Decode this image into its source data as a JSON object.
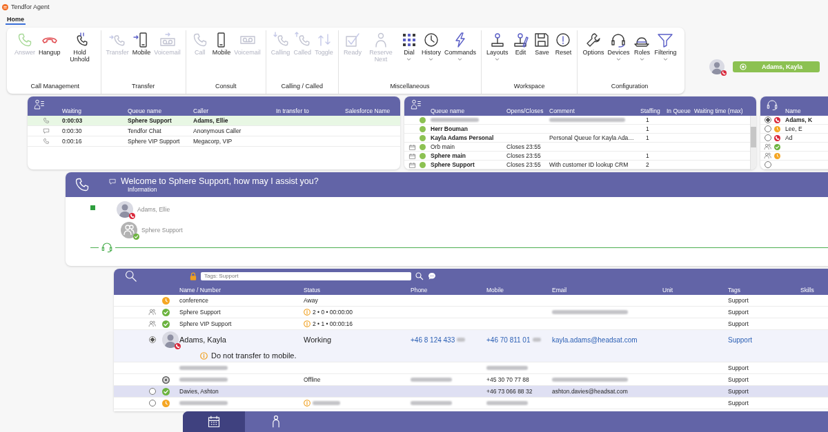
{
  "window": {
    "title": "Tendfor Agent"
  },
  "tabs": [
    {
      "label": "Home",
      "selected": true
    }
  ],
  "ribbon": [
    {
      "label": "Call Management",
      "buttons": [
        {
          "label": "Answer",
          "disabled": true,
          "dropdown": false
        },
        {
          "label": "Hangup",
          "disabled": false,
          "dropdown": false
        },
        {
          "label": "Hold Unhold",
          "disabled": false,
          "dropdown": false
        }
      ]
    },
    {
      "label": "Transfer",
      "buttons": [
        {
          "label": "Transfer",
          "disabled": true,
          "dropdown": false
        },
        {
          "label": "Mobile",
          "disabled": false,
          "dropdown": false
        },
        {
          "label": "Voicemail",
          "disabled": true,
          "dropdown": false
        }
      ]
    },
    {
      "label": "Consult",
      "buttons": [
        {
          "label": "Call",
          "disabled": true,
          "dropdown": false
        },
        {
          "label": "Mobile",
          "disabled": false,
          "dropdown": false
        },
        {
          "label": "Voicemail",
          "disabled": true,
          "dropdown": false
        }
      ]
    },
    {
      "label": "Calling / Called",
      "buttons": [
        {
          "label": "Calling",
          "disabled": true,
          "dropdown": false
        },
        {
          "label": "Called",
          "disabled": true,
          "dropdown": false
        },
        {
          "label": "Toggle",
          "disabled": true,
          "dropdown": false
        }
      ]
    },
    {
      "label": "Miscellaneous",
      "buttons": [
        {
          "label": "Ready",
          "disabled": true,
          "dropdown": false
        },
        {
          "label": "Reserve Next",
          "disabled": true,
          "dropdown": false
        },
        {
          "label": "Dial",
          "disabled": false,
          "dropdown": true
        },
        {
          "label": "History",
          "disabled": false,
          "dropdown": true
        },
        {
          "label": "Commands",
          "disabled": false,
          "dropdown": true
        }
      ]
    },
    {
      "label": "Workspace",
      "buttons": [
        {
          "label": "Layouts",
          "disabled": false,
          "dropdown": true
        },
        {
          "label": "Edit",
          "disabled": false,
          "dropdown": false
        },
        {
          "label": "Save",
          "disabled": false,
          "dropdown": false
        },
        {
          "label": "Reset",
          "disabled": false,
          "dropdown": false
        }
      ]
    },
    {
      "label": "Configuration",
      "buttons": [
        {
          "label": "Options",
          "disabled": false,
          "dropdown": false
        },
        {
          "label": "Devices",
          "disabled": false,
          "dropdown": true
        },
        {
          "label": "Roles",
          "disabled": false,
          "dropdown": true
        },
        {
          "label": "Filtering",
          "disabled": false,
          "dropdown": true
        }
      ]
    }
  ],
  "user": {
    "name": "Adams, Kayla",
    "status": {
      "kind": "busy",
      "color": "#d9283b"
    }
  },
  "waiting": {
    "columns": [
      "Waiting",
      "Queue name",
      "Caller",
      "In transfer to",
      "Salesforce Name"
    ],
    "rows": [
      {
        "kind": "phone",
        "waiting": "0:00:03",
        "queue": "Sphere Support",
        "caller": "Adams, Ellie",
        "selected": true
      },
      {
        "kind": "chat",
        "waiting": "0:00:30",
        "queue": "Tendfor Chat",
        "caller": "Anonymous Caller",
        "selected": false
      },
      {
        "kind": "phone",
        "waiting": "0:00:16",
        "queue": "Sphere VIP Support",
        "caller": "Megacorp, VIP",
        "selected": false
      }
    ]
  },
  "queues": {
    "columns": [
      "Queue name",
      "Opens/Closes",
      "Comment",
      "Staffing",
      "In Queue",
      "Waiting time (max)"
    ],
    "rows": [
      {
        "name_blurred": true,
        "comment_blurred": true,
        "staffing": "1",
        "scheduled": false
      },
      {
        "name": "Herr Bouman",
        "active": true,
        "staffing": "1",
        "scheduled": false
      },
      {
        "name": "Kayla Adams Personal",
        "active": true,
        "comment": "Personal Queue for Kayla Ada…",
        "staffing": "1",
        "scheduled": false
      },
      {
        "name": "Orb main",
        "active": false,
        "hours": "Closes 23:55",
        "scheduled": true
      },
      {
        "name": "Sphere main",
        "active": true,
        "hours": "Closes 23:55",
        "staffing": "1",
        "scheduled": true
      },
      {
        "name": "Sphere Support",
        "active": true,
        "hours": "Closes 23:55",
        "comment": "With customer ID lookup CRM",
        "staffing": "2",
        "scheduled": true
      }
    ]
  },
  "agents": {
    "columns": [
      "Name"
    ],
    "rows": [
      {
        "kind": "person",
        "selected": true,
        "status": {
          "kind": "busy",
          "color": "#d9283b"
        },
        "name": "Adams, K"
      },
      {
        "kind": "person",
        "selected": false,
        "status": {
          "kind": "away",
          "color": "#f5a623"
        },
        "name": "Lee, E"
      },
      {
        "kind": "person",
        "selected": false,
        "status": {
          "kind": "busy",
          "color": "#d9283b"
        },
        "name": "Ad"
      },
      {
        "kind": "group",
        "status": {
          "kind": "available",
          "color": "#6cb33f"
        }
      },
      {
        "kind": "group",
        "status": {
          "kind": "away",
          "color": "#f5a623"
        }
      },
      {
        "kind": "person",
        "selected": false
      }
    ]
  },
  "call": {
    "title": "Welcome to Sphere Support, how may I assist you?",
    "subtitle": "Information",
    "connected": true,
    "participants": [
      {
        "kind": "person",
        "name": "Adams, Ellie",
        "status": {
          "kind": "busy",
          "color": "#d9283b"
        }
      },
      {
        "kind": "group",
        "name": "Sphere Support",
        "status": {
          "kind": "available",
          "color": "#6cb33f"
        }
      }
    ]
  },
  "directory": {
    "search": {
      "value": "Tags: Support"
    },
    "columns": [
      "Name / Number",
      "Status",
      "Phone",
      "Mobile",
      "Email",
      "Unit",
      "Tags",
      "Skills"
    ],
    "rows": [
      {
        "kind": "number",
        "expanded": false,
        "highlighted": false,
        "status": {
          "kind": "away",
          "color": "#f5a623"
        },
        "name": "conference",
        "status_text": "Away",
        "tags": "Support"
      },
      {
        "kind": "group",
        "expanded": false,
        "highlighted": false,
        "status": {
          "kind": "available",
          "color": "#6cb33f"
        },
        "name": "Sphere Support",
        "queue_stats": "2 • 0 • 00:00:00",
        "email_blurred": true,
        "tags": "Support"
      },
      {
        "kind": "group",
        "expanded": false,
        "highlighted": false,
        "status": {
          "kind": "available",
          "color": "#6cb33f"
        },
        "name": "Sphere VIP Support",
        "queue_stats": "2 • 1 • 00:00:16",
        "tags": "Support"
      },
      {
        "kind": "person",
        "selected": true,
        "expanded": true,
        "highlighted": false,
        "status": {
          "kind": "busy",
          "color": "#d9283b"
        },
        "name": "Adams, Kayla",
        "status_text": "Working",
        "phone": "+46 8 124 433",
        "phone_blurred": true,
        "mobile": "+46 70 811 01",
        "mobile_blurred": true,
        "email": "kayla.adams@headsat.com",
        "tags": "Support",
        "note": "Do not transfer to mobile."
      },
      {
        "kind": "plain",
        "expanded": false,
        "highlighted": false,
        "name_blurred": true,
        "mobile_blurred": true,
        "tags": "Support"
      },
      {
        "kind": "plain",
        "expanded": false,
        "highlighted": false,
        "status": {
          "kind": "offline",
          "color": "#666666"
        },
        "name_blurred": true,
        "status_text": "Offline",
        "phone_blurred": true,
        "mobile": "+45 30 70 77 88",
        "email_blurred": true,
        "tags": "Support"
      },
      {
        "kind": "person",
        "selected": false,
        "expanded": false,
        "highlighted": true,
        "status": {
          "kind": "available",
          "color": "#6cb33f"
        },
        "name": "Davies, Ashton",
        "mobile": "+46 73 066 88 32",
        "email": "ashton.davies@headsat.com",
        "tags": "Support"
      },
      {
        "kind": "person",
        "selected": false,
        "expanded": false,
        "highlighted": false,
        "status": {
          "kind": "away",
          "color": "#f5a623"
        },
        "name_blurred": true,
        "status_blurred": true,
        "phone_blurred": true,
        "mobile_blurred": true,
        "tags": "Support"
      }
    ]
  },
  "bottom_tabs": [
    {
      "kind": "calendar",
      "selected": true
    },
    {
      "kind": "person",
      "selected": false
    }
  ]
}
